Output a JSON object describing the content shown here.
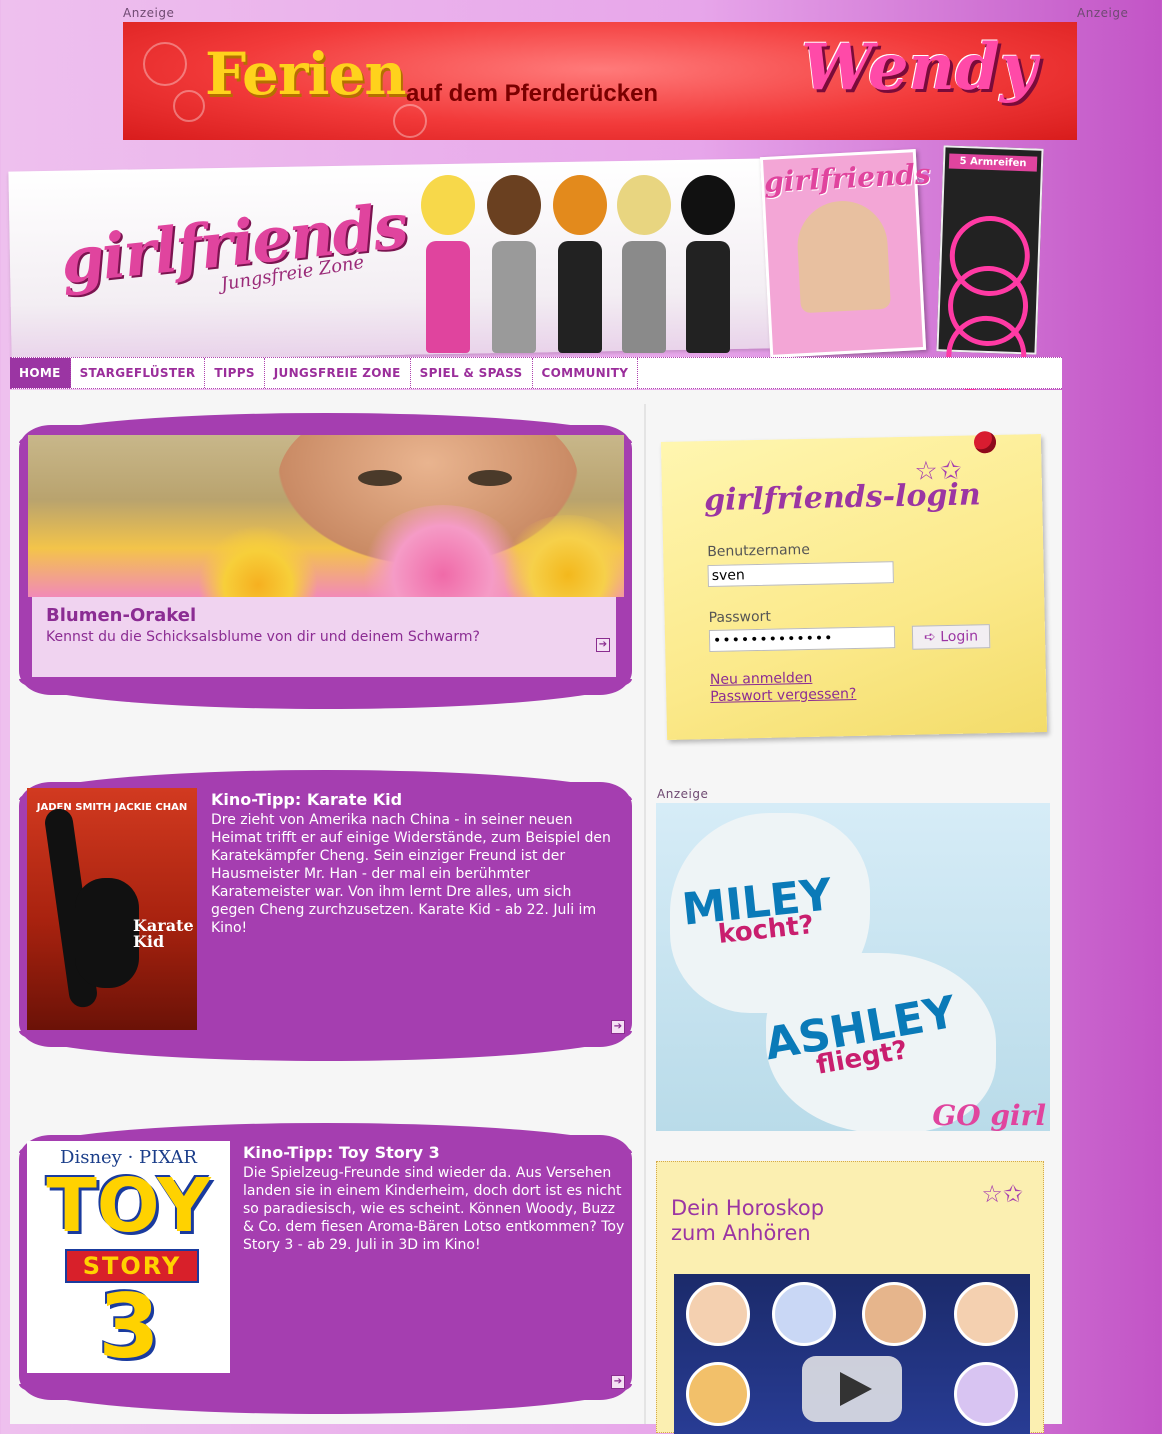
{
  "ads": {
    "label": "Anzeige",
    "top_banner": {
      "headline": "Ferien",
      "subline": "auf dem Pferderücken",
      "brand": "Wendy"
    },
    "miley_ad": {
      "line1": "MILEY",
      "line2": "kocht?",
      "line3": "ASHLEY",
      "line4": "fliegt?",
      "brand": "GO girl"
    }
  },
  "header": {
    "logo": "girlfriends",
    "logo_sub": "Jungsfreie Zone",
    "magazine_title": "girlfriends",
    "magazine_extra": "5 Armreifen"
  },
  "nav": {
    "items": [
      {
        "label": "HOME",
        "active": true
      },
      {
        "label": "STARGEFLÜSTER"
      },
      {
        "label": "TIPPS"
      },
      {
        "label": "JUNGSFREIE ZONE"
      },
      {
        "label": "SPIEL & SPASS"
      },
      {
        "label": "COMMUNITY"
      }
    ]
  },
  "teasers": [
    {
      "title": "Blumen-Orakel",
      "text": "Kennst du die Schicksalsblume von dir und deinem Schwarm?"
    },
    {
      "title": "Kino-Tipp: Karate Kid",
      "text": "Dre zieht von Amerika nach China - in seiner neuen Heimat trifft er auf einige Widerstände, zum Beispiel den Karatekämpfer Cheng. Sein einziger Freund ist der Hausmeister Mr. Han - der mal ein berühmter Karatemeister war. Von ihm lernt Dre alles, um sich gegen Cheng zurchzusetzen. Karate Kid - ab 22. Juli im Kino!",
      "poster_names": "JADEN SMITH   JACKIE CHAN",
      "poster_title": "Karate Kid"
    },
    {
      "title": "Kino-Tipp: Toy Story 3",
      "text": "Die Spielzeug-Freunde sind wieder da. Aus Versehen landen sie in einem Kinderheim, doch dort ist es nicht so paradiesisch, wie es scheint. Können Woody, Buzz & Co. dem fiesen Aroma-Bären Lotso entkommen? Toy Story 3 - ab 29. Juli in 3D im Kino!",
      "poster_brand": "Disney · PIXAR",
      "poster_title1": "TOY",
      "poster_title2": "STORY",
      "poster_title3": "3"
    }
  ],
  "login": {
    "title": "girlfriends-login",
    "username_label": "Benutzername",
    "username_value": "sven",
    "password_label": "Passwort",
    "password_value": "•••••••••••••",
    "button_label": "➪ Login",
    "register_link": "Neu anmelden",
    "forgot_link": "Passwort vergessen?"
  },
  "horoscope": {
    "title": "Dein Horoskop zum Anhören"
  },
  "colors": {
    "brand_purple": "#a53eb0",
    "nav_text": "#9b2e9b",
    "note_yellow": "#fbe98a"
  },
  "icons": [
    "arrow-right-icon",
    "pin-icon",
    "stars-icon",
    "play-icon"
  ]
}
